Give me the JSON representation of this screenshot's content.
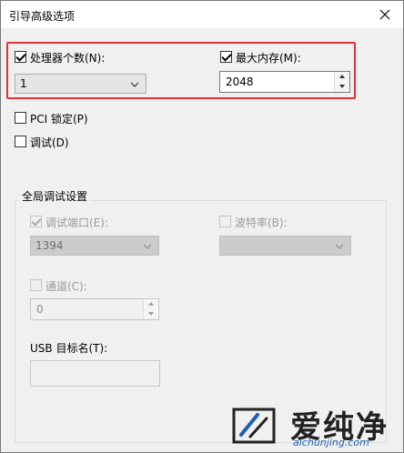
{
  "window": {
    "title": "引导高级选项"
  },
  "processors": {
    "label": "处理器个数(N):",
    "checked": true,
    "value": "1"
  },
  "max_memory": {
    "label": "最大内存(M):",
    "checked": true,
    "value": "2048"
  },
  "pci_lock": {
    "label": "PCI 锁定(P)",
    "checked": false
  },
  "debug": {
    "label": "调试(D)",
    "checked": false
  },
  "global_debug": {
    "group_title": "全局调试设置",
    "debug_port": {
      "label": "调试端口(E):",
      "checked": true,
      "value": "1394"
    },
    "baud_rate": {
      "label": "波特率(B):",
      "checked": false,
      "value": ""
    },
    "channel": {
      "label": "通道(C):",
      "checked": false,
      "value": "0"
    },
    "usb_target": {
      "label": "USB 目标名(T):",
      "value": ""
    }
  },
  "watermark": {
    "text": "爱纯净",
    "url": "aichunjing.com"
  },
  "colors": {
    "highlight": "#e0343a",
    "dialog_bg": "#f0f0f0"
  }
}
